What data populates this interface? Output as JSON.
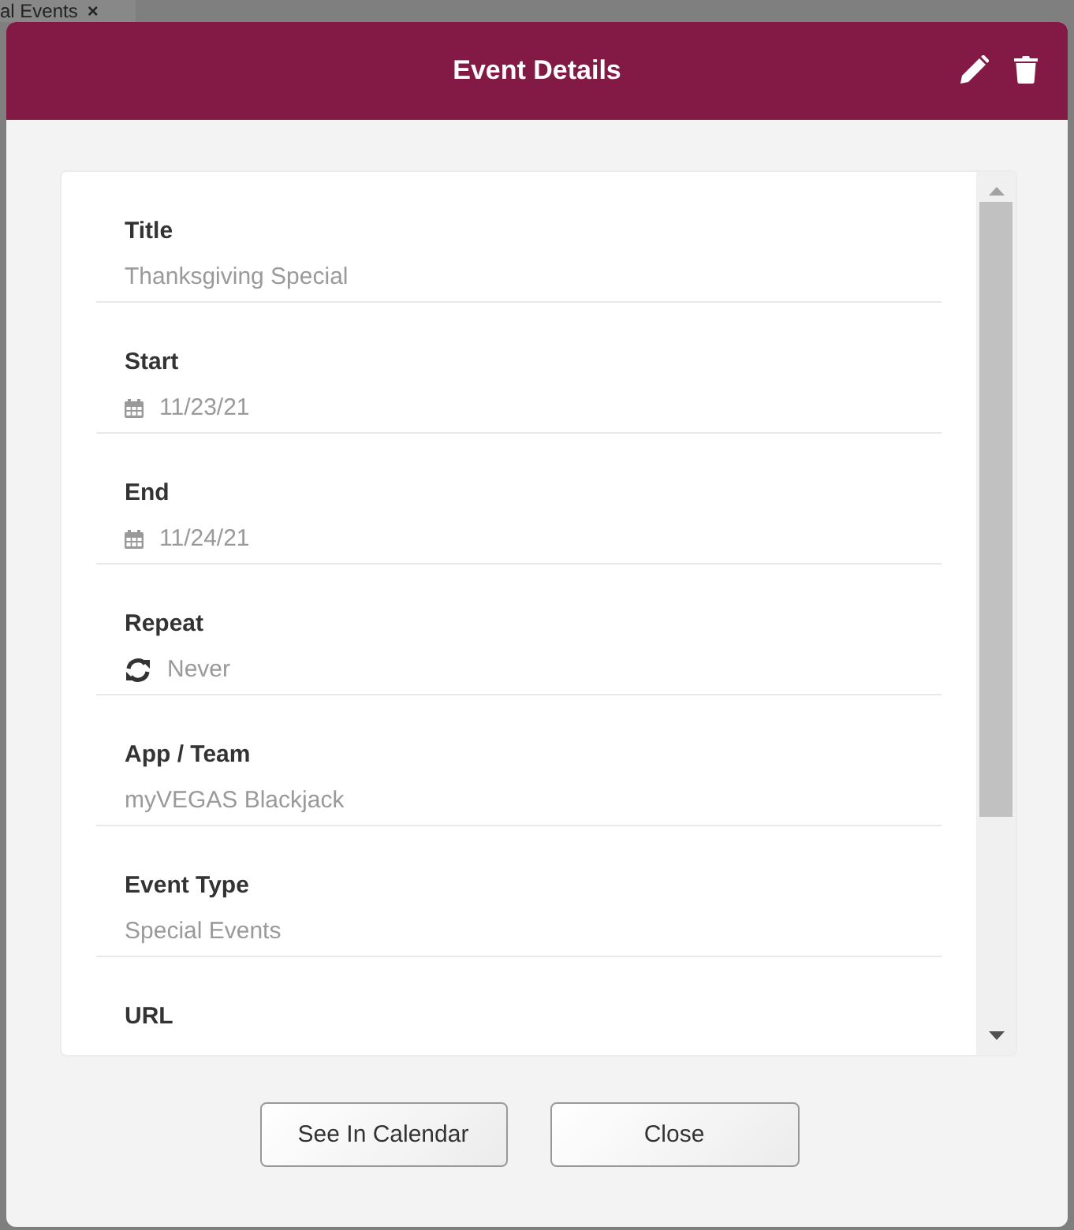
{
  "background_tab": {
    "label": "al Events",
    "close": "×"
  },
  "dialog": {
    "title": "Event Details",
    "fields": [
      {
        "label": "Title",
        "kind": "text",
        "value": "Thanksgiving Special"
      },
      {
        "label": "Start",
        "kind": "date",
        "value": "11/23/21"
      },
      {
        "label": "End",
        "kind": "date",
        "value": "11/24/21"
      },
      {
        "label": "Repeat",
        "kind": "repeat",
        "value": "Never"
      },
      {
        "label": "App / Team",
        "kind": "text",
        "value": "myVEGAS Blackjack"
      },
      {
        "label": "Event Type",
        "kind": "text",
        "value": "Special Events"
      },
      {
        "label": "URL",
        "kind": "text"
      }
    ],
    "buttons": [
      "See In Calendar",
      "Close"
    ]
  }
}
